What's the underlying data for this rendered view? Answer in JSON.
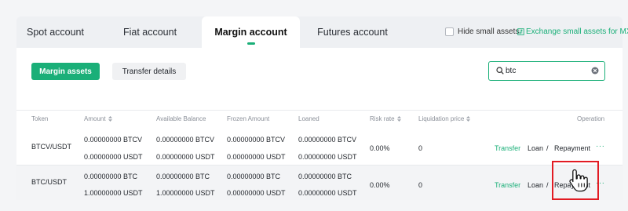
{
  "tabs": {
    "spot": "Spot account",
    "fiat": "Fiat account",
    "margin": "Margin account",
    "futures": "Futures account"
  },
  "options": {
    "hide_small": "Hide small assets",
    "exchange_small": "Exchange small assets for MX"
  },
  "toolbar": {
    "margin_assets": "Margin assets",
    "transfer_details": "Transfer details"
  },
  "search": {
    "value": "btc"
  },
  "table": {
    "headers": {
      "token": "Token",
      "amount": "Amount",
      "available": "Available Balance",
      "frozen": "Frozen Amount",
      "loaned": "Loaned",
      "risk": "Risk rate",
      "liquidation": "Liquidation price",
      "operation": "Operation"
    },
    "rows": [
      {
        "token": "BTCV/USDT",
        "amount": [
          "0.00000000 BTCV",
          "0.00000000 USDT"
        ],
        "available": [
          "0.00000000 BTCV",
          "0.00000000 USDT"
        ],
        "frozen": [
          "0.00000000 BTCV",
          "0.00000000 USDT"
        ],
        "loaned": [
          "0.00000000 BTCV",
          "0.00000000 USDT"
        ],
        "risk": "0.00%",
        "liquidation": "0",
        "ops": {
          "transfer": "Transfer",
          "loan": "Loan",
          "slash": "/",
          "repayment": "Repayment",
          "more": "···"
        }
      },
      {
        "token": "BTC/USDT",
        "amount": [
          "0.00000000 BTC",
          "1.00000000 USDT"
        ],
        "available": [
          "0.00000000 BTC",
          "1.00000000 USDT"
        ],
        "frozen": [
          "0.00000000 BTC",
          "0.00000000 USDT"
        ],
        "loaned": [
          "0.00000000 BTC",
          "0.00000000 USDT"
        ],
        "risk": "0.00%",
        "liquidation": "0",
        "ops": {
          "transfer": "Transfer",
          "loan": "Loan",
          "slash": "/",
          "repayment": "Repayment",
          "more": "···"
        }
      }
    ]
  },
  "colors": {
    "accent": "#1aaf78",
    "highlight": "#e21b23"
  },
  "icons": {
    "search": "search-icon",
    "clear": "clear-icon",
    "exchange": "exchange-icon",
    "sort": "sort-icon",
    "cursor": "hand-pointer-icon"
  }
}
